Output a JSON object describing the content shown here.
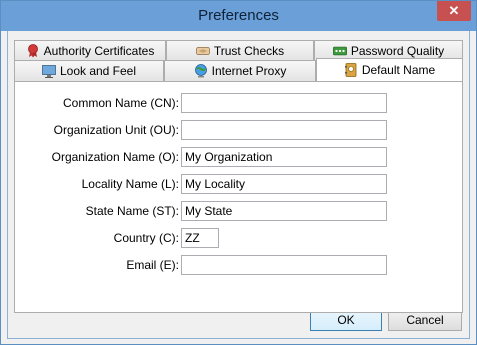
{
  "window": {
    "title": "Preferences",
    "close_glyph": "✕"
  },
  "tabs_row_back": [
    {
      "label": "Authority Certificates",
      "icon": "certificate-ribbon-icon"
    },
    {
      "label": "Trust Checks",
      "icon": "handshake-icon"
    },
    {
      "label": "Password Quality",
      "icon": "password-dots-icon"
    }
  ],
  "tabs_row_front": [
    {
      "label": "Look and Feel",
      "icon": "monitor-icon"
    },
    {
      "label": "Internet Proxy",
      "icon": "globe-icon"
    },
    {
      "label": "Default Name",
      "icon": "address-book-icon",
      "active": true
    }
  ],
  "form": {
    "fields": [
      {
        "label": "Common Name (CN):",
        "value": ""
      },
      {
        "label": "Organization Unit (OU):",
        "value": ""
      },
      {
        "label": "Organization Name (O):",
        "value": "My Organization"
      },
      {
        "label": "Locality Name (L):",
        "value": "My Locality"
      },
      {
        "label": "State Name (ST):",
        "value": "My State"
      },
      {
        "label": "Country (C):",
        "value": "ZZ"
      },
      {
        "label": "Email (E):",
        "value": ""
      }
    ]
  },
  "buttons": {
    "ok": "OK",
    "cancel": "Cancel"
  },
  "colors": {
    "titlebar": "#6b9fd7",
    "close": "#c75050"
  }
}
